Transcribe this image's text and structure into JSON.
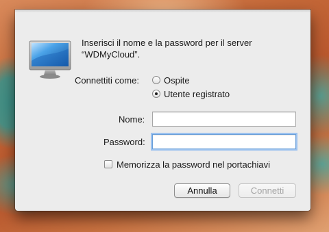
{
  "dialog": {
    "message": "Inserisci il nome e la password per il server “WDMyCloud”.",
    "connect_as_label": "Connettiti come:",
    "options": [
      {
        "label": "Ospite",
        "selected": false
      },
      {
        "label": "Utente registrato",
        "selected": true
      }
    ],
    "name_label": "Nome:",
    "name_value": "",
    "password_label": "Password:",
    "password_value": "",
    "remember_label": "Memorizza la password nel portachiavi",
    "remember_checked": false,
    "cancel_label": "Annulla",
    "connect_label": "Connetti"
  },
  "icons": {
    "server": "monitor-icon"
  }
}
